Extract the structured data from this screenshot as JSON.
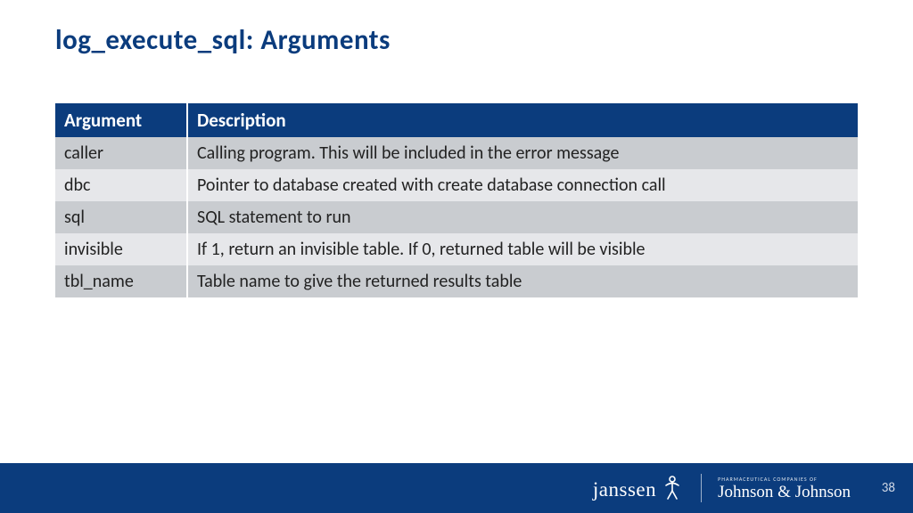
{
  "title": "log_execute_sql: Arguments",
  "table": {
    "headers": {
      "c0": "Argument",
      "c1": "Description"
    },
    "rows": [
      {
        "c0": "caller",
        "c1": "Calling program.  This will be included in the error message"
      },
      {
        "c0": "dbc",
        "c1": "Pointer to database created with create database connection call"
      },
      {
        "c0": "sql",
        "c1": "SQL statement to run"
      },
      {
        "c0": "invisible",
        "c1": "If 1, return an invisible table.  If 0, returned table will be visible"
      },
      {
        "c0": "tbl_name",
        "c1": "Table name to give the returned results table"
      }
    ]
  },
  "footer": {
    "brand1": "janssen",
    "jj_small": "PHARMACEUTICAL COMPANIES OF",
    "jj_script": "Johnson & Johnson",
    "page": "38"
  }
}
